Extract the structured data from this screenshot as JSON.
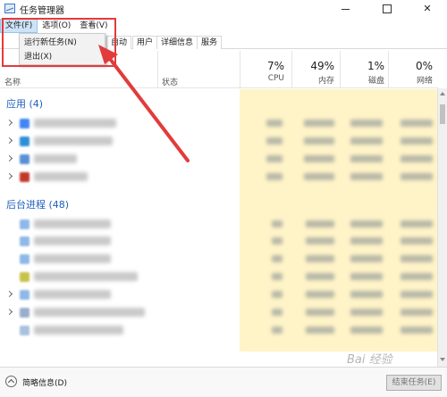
{
  "window": {
    "title": "任务管理器",
    "minimize_glyph": "",
    "maximize_glyph": "",
    "close_glyph": "✕"
  },
  "menubar": [
    {
      "label": "文件(F)",
      "active": true
    },
    {
      "label": "选项(O)",
      "active": false
    },
    {
      "label": "查看(V)",
      "active": false
    }
  ],
  "file_menu": {
    "items": [
      "运行新任务(N)",
      "退出(X)"
    ]
  },
  "tabs": [
    "自动",
    "用户",
    "详细信息",
    "服务"
  ],
  "columns": {
    "name": "名称",
    "status": "状态",
    "cpu": {
      "pct": "7%",
      "label": "CPU"
    },
    "memory": {
      "pct": "49%",
      "label": "内存"
    },
    "disk": {
      "pct": "1%",
      "label": "磁盘"
    },
    "network": {
      "pct": "0%",
      "label": "网络"
    }
  },
  "groups": {
    "apps": "应用 (4)",
    "background": "后台进程 (48)"
  },
  "footer": {
    "brief_info": "简略信息(D)",
    "end_task": "结束任务(E)"
  },
  "watermark": "Bai 经验",
  "colors": {
    "accent_blue": "#1f5fbf",
    "highlight_red": "#e23b3b",
    "heat_yellow": "#fff4c8"
  }
}
